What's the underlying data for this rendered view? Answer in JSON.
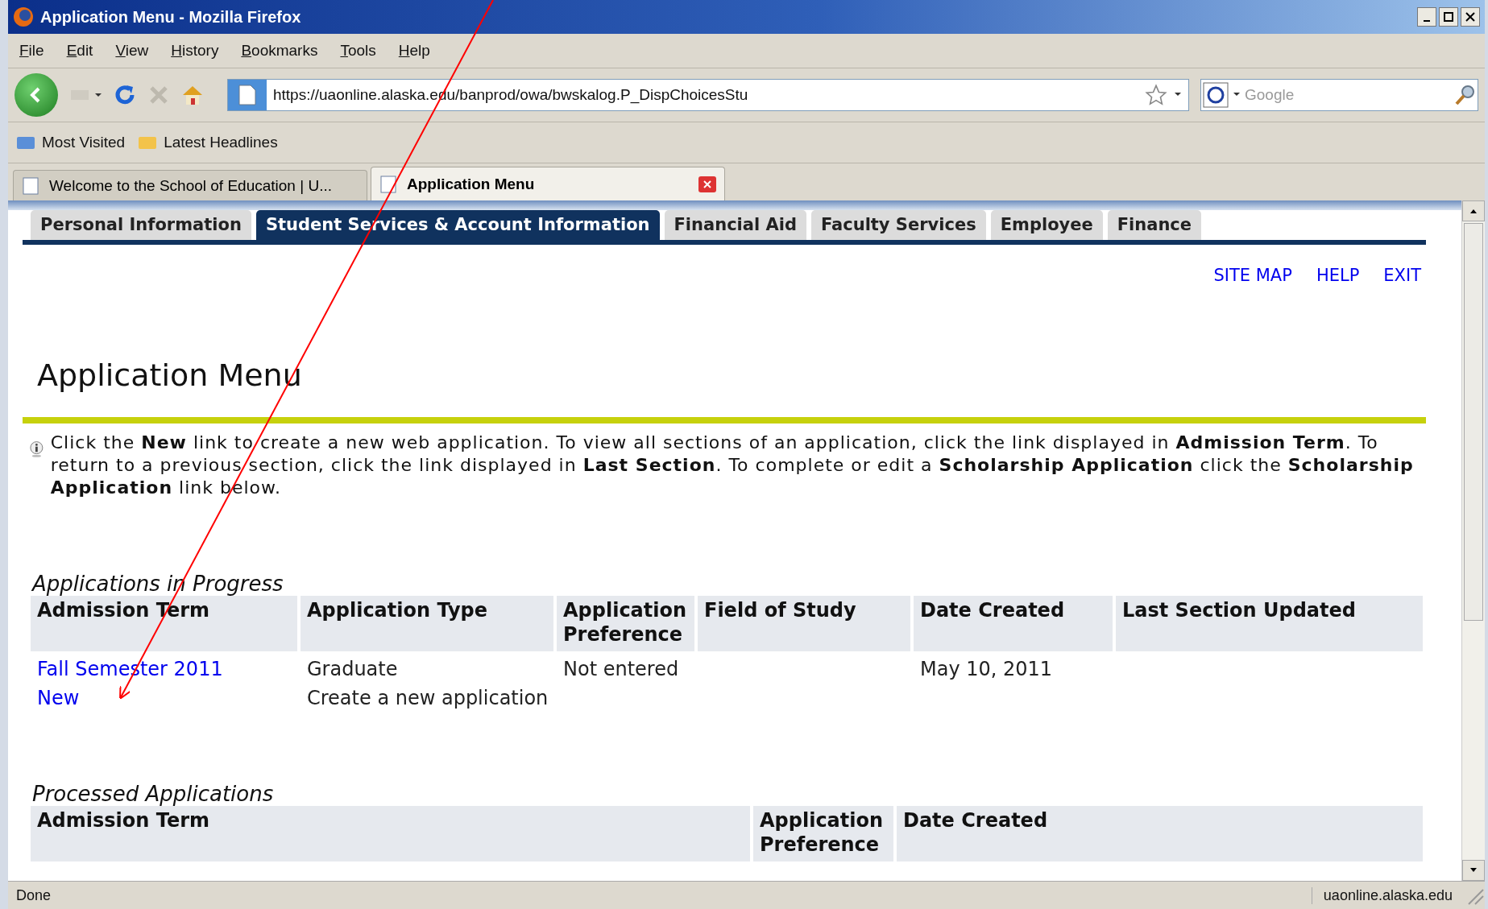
{
  "window": {
    "title": "Application Menu - Mozilla Firefox"
  },
  "menu": [
    "File",
    "Edit",
    "View",
    "History",
    "Bookmarks",
    "Tools",
    "Help"
  ],
  "address": {
    "url": "https://uaonline.alaska.edu/banprod/owa/bwskalog.P_DispChoicesStu"
  },
  "search": {
    "placeholder": "Google"
  },
  "bookmarks": [
    "Most Visited",
    "Latest Headlines"
  ],
  "browser_tabs": [
    {
      "label": "Welcome to the School of Education | U...",
      "selected": false
    },
    {
      "label": "Application Menu",
      "selected": true
    }
  ],
  "page": {
    "nav_tabs": [
      {
        "label": "Personal Information",
        "selected": false
      },
      {
        "label": "Student Services & Account Information",
        "selected": true
      },
      {
        "label": "Financial Aid",
        "selected": false
      },
      {
        "label": "Faculty Services",
        "selected": false
      },
      {
        "label": "Employee",
        "selected": false
      },
      {
        "label": "Finance",
        "selected": false
      }
    ],
    "top_links": [
      "SITE MAP",
      "HELP",
      "EXIT"
    ],
    "heading": "Application Menu",
    "info": "Click the **New** link to create a new web application. To view all sections of an application, click the link displayed in **Admission Term**. To return to a previous section, click the link displayed in **Last Section**. To complete or edit a **Scholarship Application** click the **Scholarship Application** link below.",
    "in_progress": {
      "title": "Applications in Progress",
      "columns": [
        "Admission Term",
        "Application Type",
        "Application Preference",
        "Field of Study",
        "Date Created",
        "Last Section Updated"
      ],
      "rows": [
        {
          "term": "Fall Semester 2011",
          "type": "Graduate",
          "preference": "Not entered",
          "date": "May 10, 2011"
        },
        {
          "term": "New",
          "type": "Create a new application"
        }
      ]
    },
    "processed": {
      "title": "Processed Applications",
      "columns": [
        "Admission Term",
        "Application Preference",
        "Date Created"
      ]
    }
  },
  "status_bar": {
    "left": "Done",
    "right": "uaonline.alaska.edu"
  }
}
